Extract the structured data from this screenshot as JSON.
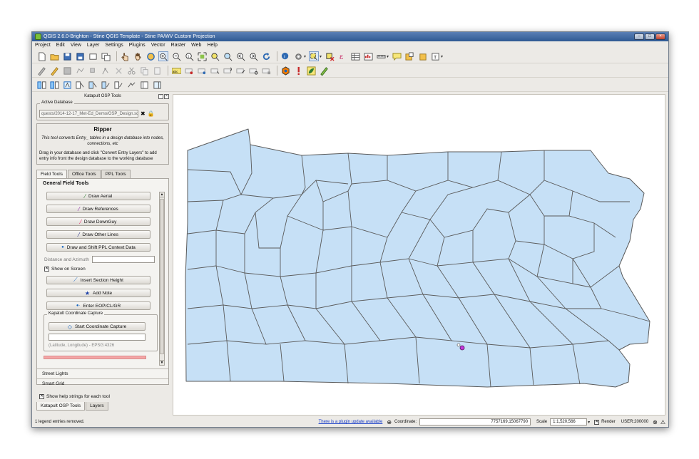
{
  "window": {
    "title": "QGIS 2.6.0-Brighton - Stine QGIS Template - Stine PA/WV Custom Projection",
    "controls": [
      "–",
      "□",
      "×"
    ]
  },
  "menubar": [
    "Project",
    "Edit",
    "View",
    "Layer",
    "Settings",
    "Plugins",
    "Vector",
    "Raster",
    "Web",
    "Help"
  ],
  "panel": {
    "title": "Katapult OSP Tools",
    "active_database": {
      "label": "Active Database",
      "value": "quests/2014-12-17_Met-Ed_Demo/OSP_Design.sqlite"
    },
    "ripper": {
      "heading": "Ripper",
      "description": "This tool converts Entry_ tables in a design database into nodes, connections, etc",
      "instructions": "Drag in your database and click \"Convert Entry Layers\" to add entry info front the design database to the working database"
    },
    "tabs": [
      "Field Tools",
      "Office Tools",
      "PPL Tools"
    ],
    "general_header": "General Field Tools",
    "buttons": {
      "draw_aerial": "Draw Aerial",
      "draw_references": "Draw References",
      "draw_downguy": "Draw DownGuy",
      "draw_other_lines": "Draw Other Lines",
      "draw_shift_ppl": "Draw and Shift PPL Context Data",
      "insert_section_height": "Insert Section Height",
      "add_note": "Add Note",
      "enter_eop": "Enter EOP/CL/GR",
      "start_capture": "Start Coordinate Capture"
    },
    "distance_label": "Distance and Azimuth",
    "show_on_screen": "Show on Screen",
    "capture_group_label": "Kapatult Coordinate Capture",
    "capture_hint": "(Latitude, Longitude) - EPSG:4326",
    "sections": [
      "Street Lights",
      "Smart Grid"
    ],
    "show_help": "Show help strings for each tool",
    "bottom_tabs": [
      "Katapult OSP Tools",
      "Layers"
    ]
  },
  "status": {
    "message": "1 legend entries removed.",
    "update_link": "There is a plugin update available",
    "coordinate_label": "Coordinate:",
    "coordinate_value": "7757169,15067790",
    "scale_label": "Scale",
    "scale_value": "1:1,520,566",
    "render_label": "Render",
    "user": "USER:200000"
  },
  "colors": {
    "county_fill": "#c6e0f6",
    "county_stroke": "#5a5a5a",
    "marker": "#c43adb"
  }
}
